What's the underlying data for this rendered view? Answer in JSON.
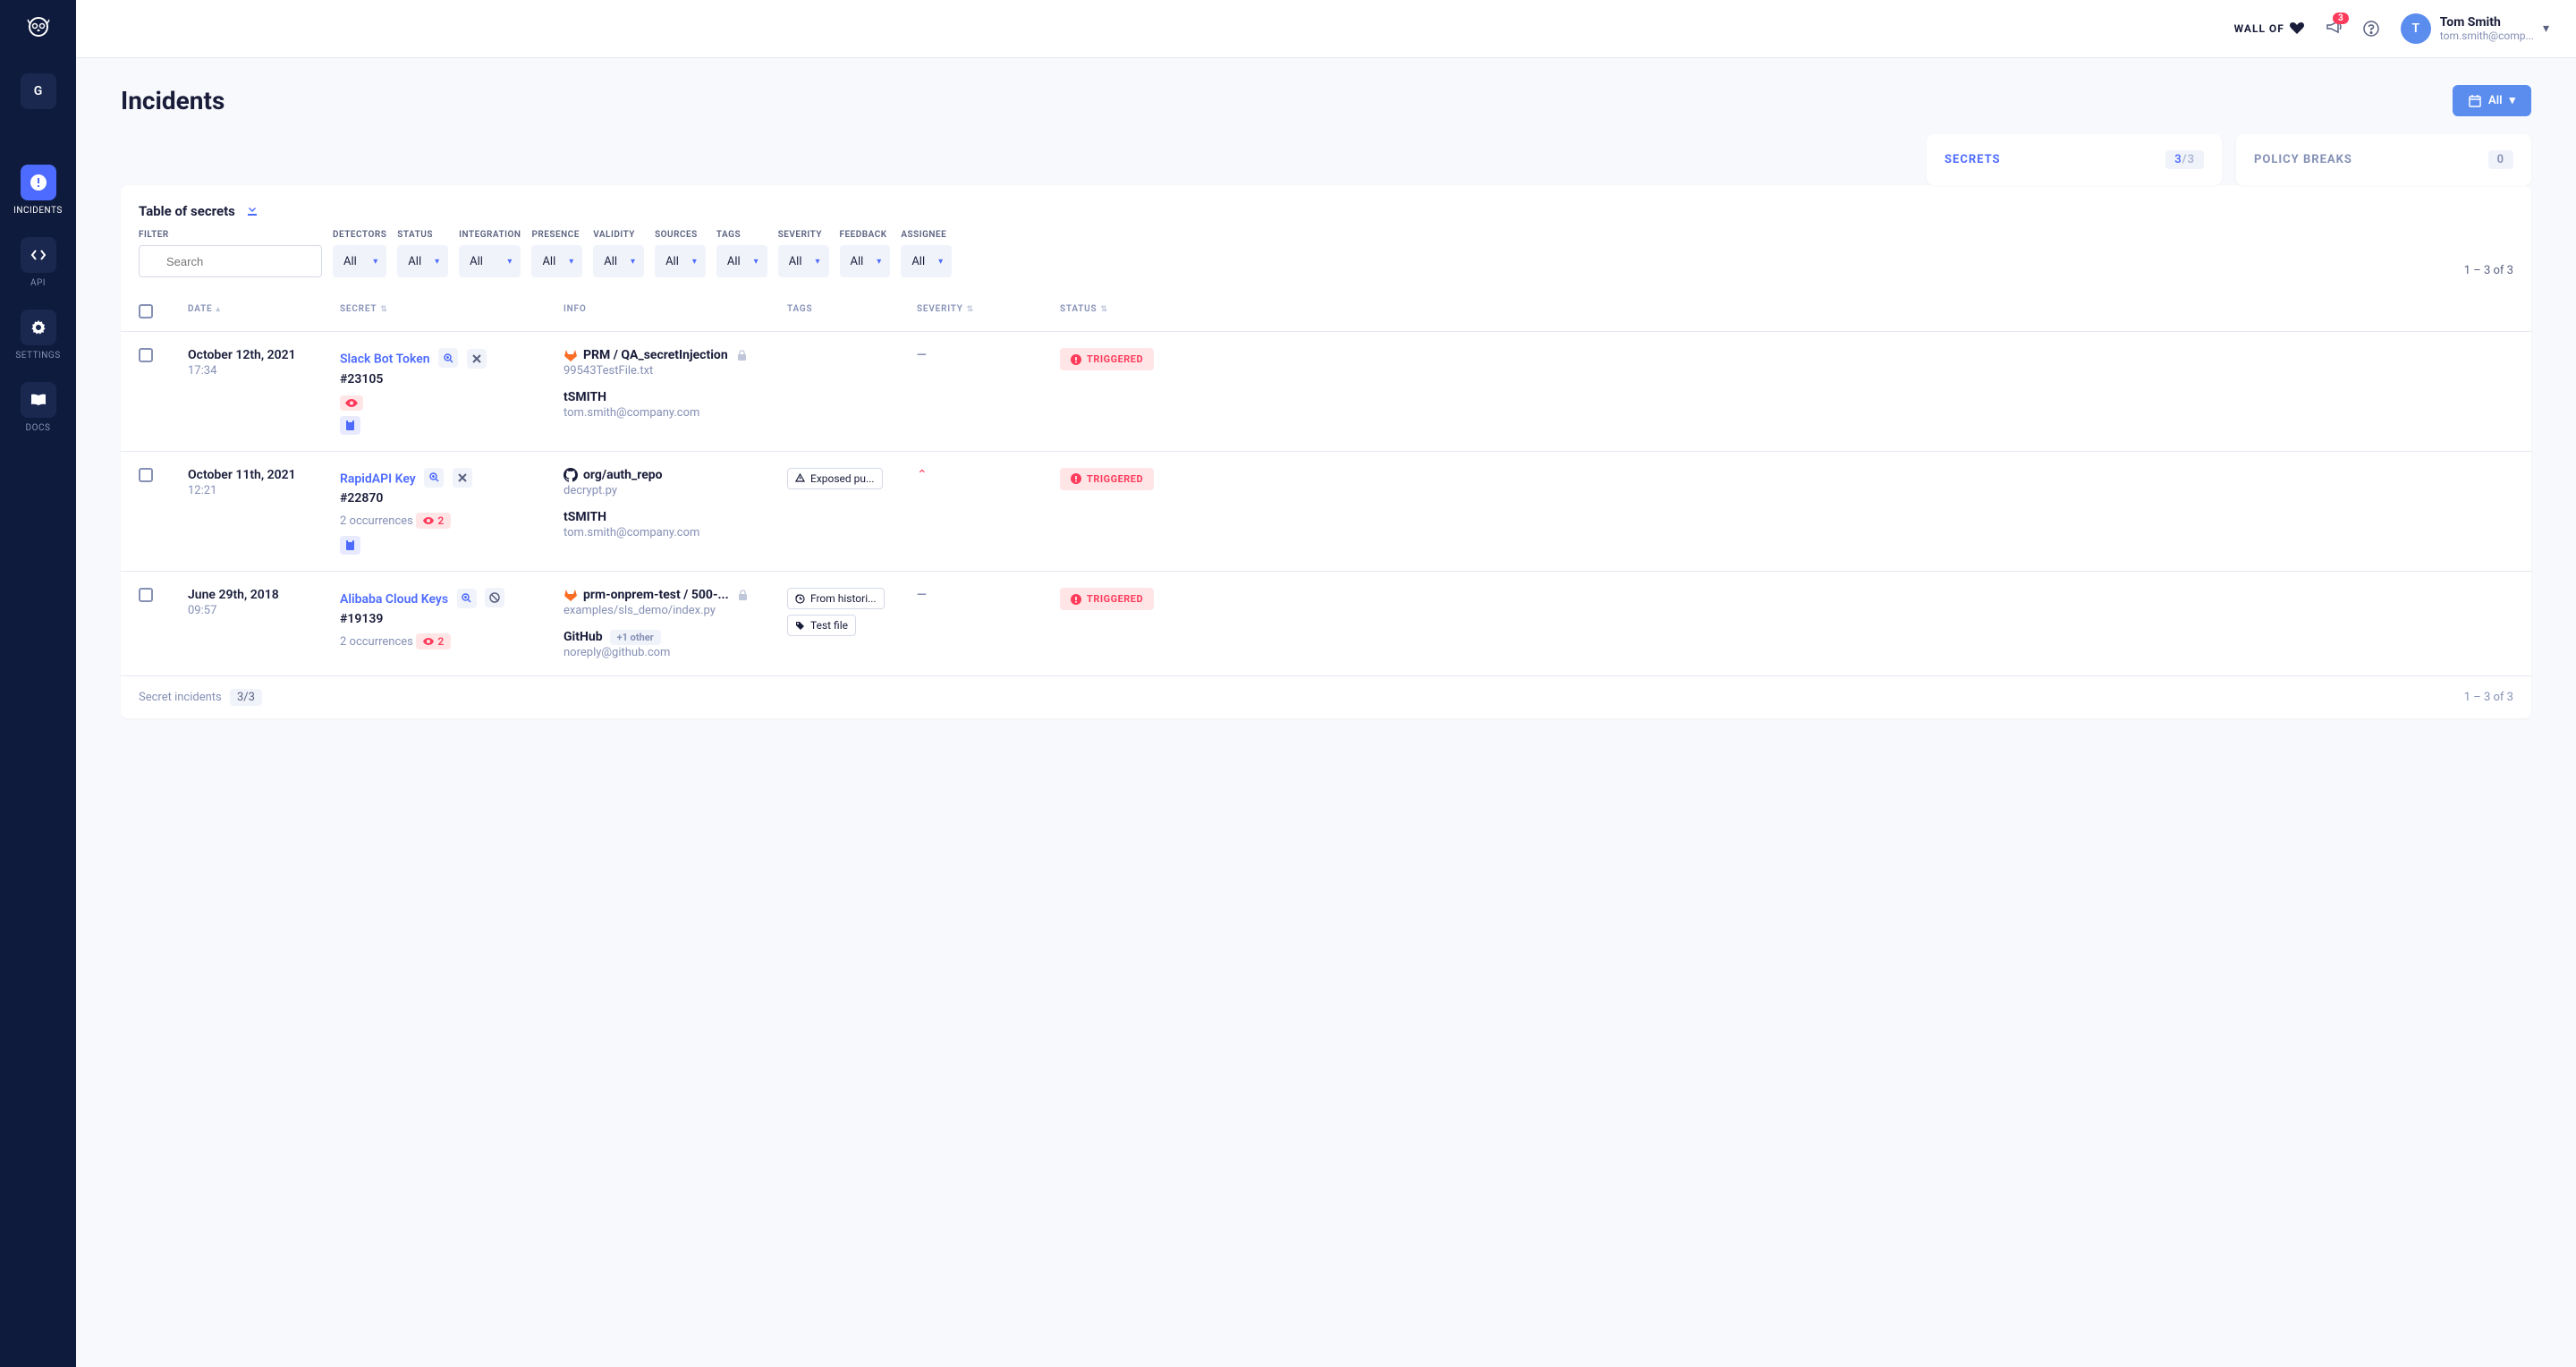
{
  "sidebar": {
    "workspace": "G",
    "items": [
      {
        "label": "INCIDENTS"
      },
      {
        "label": "API"
      },
      {
        "label": "SETTINGS"
      },
      {
        "label": "DOCS"
      }
    ]
  },
  "topbar": {
    "wall_of": "WALL OF",
    "notif_count": "3",
    "user_initial": "T",
    "user_name": "Tom Smith",
    "user_email": "tom.smith@comp..."
  },
  "page": {
    "title": "Incidents",
    "date_filter": "All"
  },
  "tabs": {
    "secrets": {
      "label": "SECRETS",
      "count": "3",
      "total": "/3"
    },
    "policy": {
      "label": "POLICY BREAKS",
      "count": "0"
    }
  },
  "panel": {
    "title": "Table of secrets",
    "filter_label": "FILTER",
    "search_placeholder": "Search",
    "filters": {
      "detectors": {
        "label": "DETECTORS",
        "value": "All"
      },
      "status": {
        "label": "STATUS",
        "value": "All"
      },
      "integration": {
        "label": "INTEGRATION",
        "value": "All"
      },
      "presence": {
        "label": "PRESENCE",
        "value": "All"
      },
      "validity": {
        "label": "VALIDITY",
        "value": "All"
      },
      "sources": {
        "label": "SOURCES",
        "value": "All"
      },
      "tags": {
        "label": "TAGS",
        "value": "All"
      },
      "severity": {
        "label": "SEVERITY",
        "value": "All"
      },
      "feedback": {
        "label": "FEEDBACK",
        "value": "All"
      },
      "assignee": {
        "label": "ASSIGNEE",
        "value": "All"
      }
    },
    "pagination": "1 – 3  of  3"
  },
  "columns": {
    "date": "DATE",
    "secret": "SECRET",
    "info": "INFO",
    "tags": "TAGS",
    "severity": "SEVERITY",
    "status": "STATUS"
  },
  "rows": [
    {
      "date": "October 12th, 2021",
      "time": "17:34",
      "secret_name": "Slack Bot Token",
      "secret_id": "#23105",
      "occurrences": "",
      "occ_count": "",
      "repo": "PRM / QA_secretInjection",
      "file": "99543TestFile.txt",
      "user": "tSMITH",
      "email": "tom.smith@company.com",
      "source_extra": "",
      "tags": [],
      "severity": "—",
      "status": "TRIGGERED",
      "icon_action": "close",
      "source": "gitlab"
    },
    {
      "date": "October 11th, 2021",
      "time": "12:21",
      "secret_name": "RapidAPI Key",
      "secret_id": "#22870",
      "occurrences": "2 occurrences",
      "occ_count": "2",
      "repo": "org/auth_repo",
      "file": "decrypt.py",
      "user": "tSMITH",
      "email": "tom.smith@company.com",
      "source_extra": "",
      "tags": [
        "Exposed pu..."
      ],
      "severity": "up",
      "status": "TRIGGERED",
      "icon_action": "close",
      "source": "github"
    },
    {
      "date": "June 29th, 2018",
      "time": "09:57",
      "secret_name": "Alibaba Cloud Keys",
      "secret_id": "#19139",
      "occurrences": "2 occurrences",
      "occ_count": "2",
      "repo": "prm-onprem-test / 500-...",
      "file": "examples/sls_demo/index.py",
      "user": "GitHub",
      "email": "noreply@github.com",
      "source_extra": "+1 other",
      "tags": [
        "From histori...",
        "Test file"
      ],
      "severity": "—",
      "status": "TRIGGERED",
      "icon_action": "ban",
      "source": "gitlab"
    }
  ],
  "footer": {
    "label": "Secret incidents",
    "count": "3/3",
    "pagination": "1 – 3  of  3"
  }
}
